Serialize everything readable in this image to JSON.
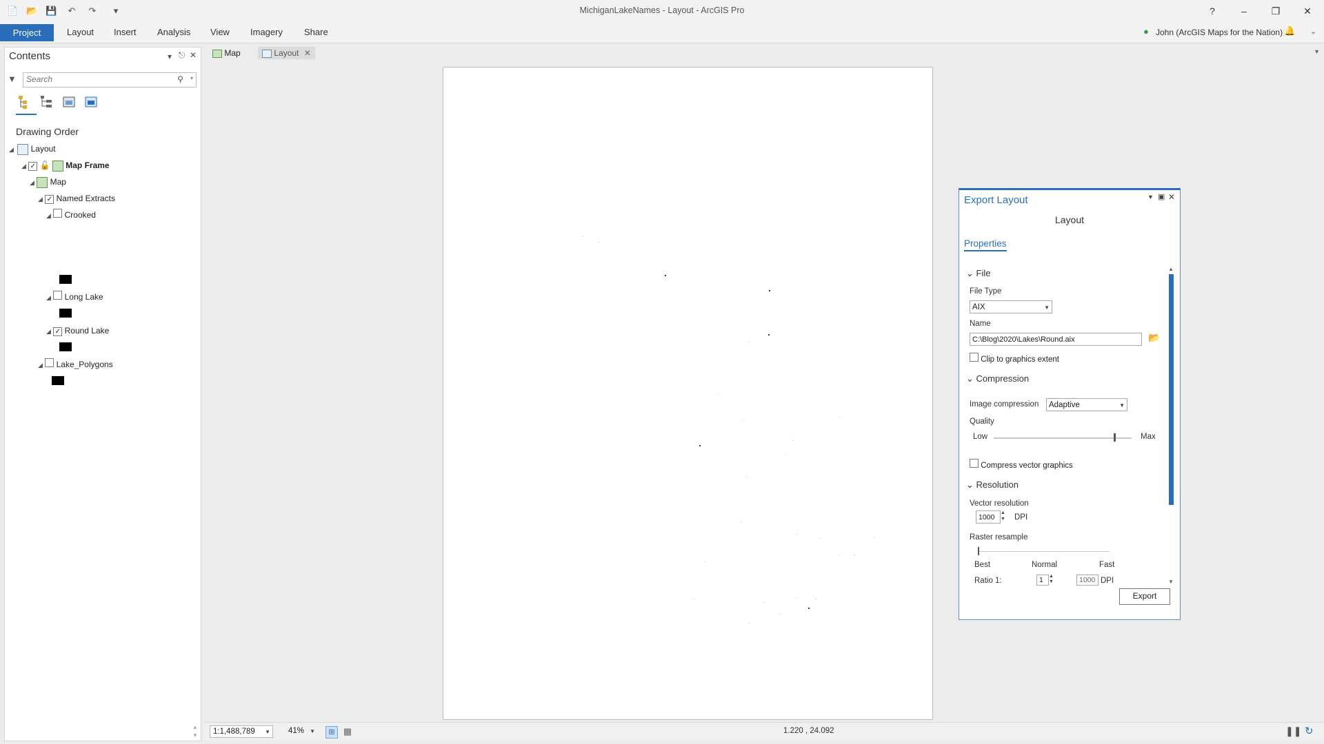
{
  "window": {
    "title": "MichiganLakeNames - Layout - ArcGIS Pro",
    "help": "?",
    "minimize": "–",
    "restore": "❐",
    "close": "✕"
  },
  "ribbon": {
    "tabs": [
      "Project",
      "Layout",
      "Insert",
      "Analysis",
      "View",
      "Imagery",
      "Share"
    ],
    "user": "John (ArcGIS Maps for the Nation)"
  },
  "contents": {
    "title": "Contents",
    "search_placeholder": "Search",
    "drawing_order_label": "Drawing Order",
    "tree": {
      "layout": "Layout",
      "map_frame": "Map Frame",
      "map": "Map",
      "named_extracts": "Named Extracts",
      "crooked": "Crooked",
      "long_lake": "Long Lake",
      "round_lake": "Round Lake",
      "lake_polygons": "Lake_Polygons"
    },
    "checks": {
      "map_frame": true,
      "named_extracts": true,
      "crooked": false,
      "long_lake": false,
      "round_lake": true,
      "lake_polygons": false
    }
  },
  "doc_tabs": [
    {
      "label": "Map",
      "active": false
    },
    {
      "label": "Layout",
      "active": true
    }
  ],
  "export_pane": {
    "title": "Export Layout",
    "subtitle": "Layout",
    "tab": "Properties",
    "file_section": "File",
    "file_type_label": "File Type",
    "file_type_value": "AIX",
    "name_label": "Name",
    "name_value": "C:\\Blog\\2020\\Lakes\\Round.aix",
    "clip_label": "Clip to graphics extent",
    "clip_checked": false,
    "compression_section": "Compression",
    "image_compression_label": "Image compression",
    "image_compression_value": "Adaptive",
    "quality_label": "Quality",
    "quality_low": "Low",
    "quality_max": "Max",
    "quality_level": 0.87,
    "compress_vector_label": "Compress vector graphics",
    "compress_vector_checked": false,
    "resolution_section": "Resolution",
    "vector_res_label": "Vector resolution",
    "vector_res_value": "1000",
    "dpi": "DPI",
    "raster_resample_label": "Raster resample",
    "resample_best": "Best",
    "resample_normal": "Normal",
    "resample_fast": "Fast",
    "ratio_label": "Ratio 1:",
    "ratio_value": "1",
    "ratio_dpi_value": "1000",
    "export_button": "Export"
  },
  "status": {
    "scale": "1:1,488,789",
    "zoom": "41%",
    "coordinates": "1.220 , 24.092"
  },
  "colors": {
    "accent": "#2a6ebb"
  }
}
